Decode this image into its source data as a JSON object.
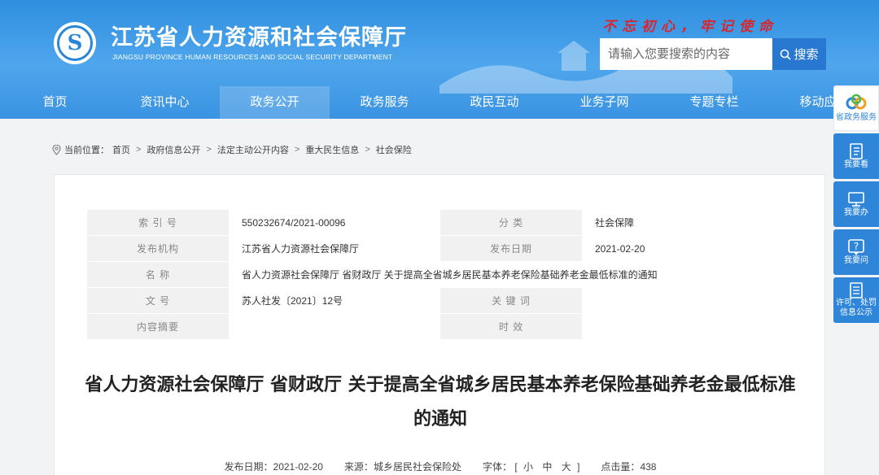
{
  "header": {
    "site_title": "江苏省人力资源和社会保障厅",
    "site_subtitle": "JIANGSU PROVINCE HUMAN RESOURCES AND SOCIAL SECURITY DEPARTMENT",
    "slogan": "不忘初心，牢记使命",
    "search_placeholder": "请输入您要搜索的内容",
    "search_label": "搜索",
    "logo_icon": "social-security-emblem-icon"
  },
  "nav": [
    "首页",
    "资讯中心",
    "政务公开",
    "政务服务",
    "政民互动",
    "业务子网",
    "专题专栏",
    "移动应用"
  ],
  "nav_active": "政务公开",
  "breadcrumb": {
    "prefix": "当前位置：",
    "items": [
      "首页",
      "政府信息公开",
      "法定主动公开内容",
      "重大民生信息",
      "社会保险"
    ]
  },
  "meta": {
    "index_label": "索  引  号",
    "index_value": "550232674/2021-00096",
    "category_label": "分      类",
    "category_value": "社会保障",
    "org_label": "发布机构",
    "org_value": "江苏省人力资源社会保障厅",
    "date_label": "发布日期",
    "date_value": "2021-02-20",
    "name_label": "名      称",
    "name_value": "省人力资源社会保障厅 省财政厅 关于提高全省城乡居民基本养老保险基础养老金最低标准的通知",
    "docno_label": "文      号",
    "docno_value": "苏人社发〔2021〕12号",
    "keyword_label": "关  键  词",
    "keyword_value": "",
    "summary_label": "内容摘要",
    "summary_value": "",
    "validity_label": "时      效",
    "validity_value": ""
  },
  "article": {
    "title": "省人力资源社会保障厅 省财政厅 关于提高全省城乡居民基本养老保险基础养老金最低标准的通知",
    "date_label": "发布日期：",
    "date": "2021-02-20",
    "source_label": "来源：",
    "source": "城乡居民社会保险处",
    "font_label": "字体：",
    "font_small": "小",
    "font_medium": "中",
    "font_large": "大",
    "bracket_open": "[",
    "bracket_close": "]",
    "views_label": "点击量：",
    "views": "438"
  },
  "float_menu": [
    {
      "label": "省政务服务",
      "icon": "gov-service-logo-icon"
    },
    {
      "label": "我要看",
      "icon": "book-icon"
    },
    {
      "label": "我要办",
      "icon": "monitor-icon"
    },
    {
      "label": "我要问",
      "icon": "question-icon"
    },
    {
      "label": "许可、处罚信息公示",
      "icon": "document-list-icon"
    }
  ],
  "colors": {
    "header_blue": "#3a93e2",
    "slogan_red": "#d8262b",
    "search_button": "#2878d2"
  }
}
